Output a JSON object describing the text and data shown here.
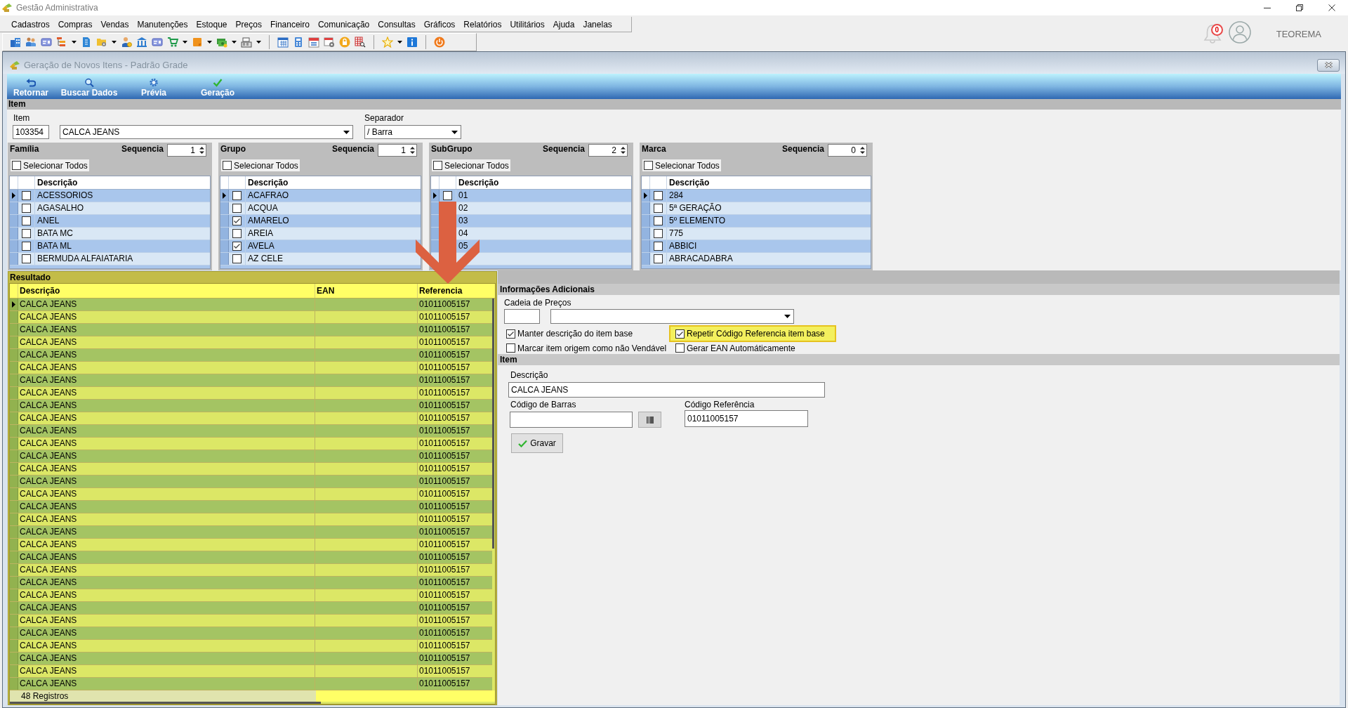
{
  "window": {
    "title": "Gestão Administrativa"
  },
  "menu": [
    "Cadastros",
    "Compras",
    "Vendas",
    "Manutenções",
    "Estoque",
    "Preços",
    "Financeiro",
    "Comunicação",
    "Consultas",
    "Gráficos",
    "Relatórios",
    "Utilitários",
    "Ajuda",
    "Janelas"
  ],
  "user_area": {
    "notifications": "0",
    "user": "TEOREMA"
  },
  "form": {
    "title": "Geração de Novos Itens - Padrão Grade",
    "actions": [
      "Retornar",
      "Buscar Dados",
      "Prévia",
      "Geração"
    ]
  },
  "item_section": {
    "title": "Item",
    "item_label": "Item",
    "item_code": "103354",
    "item_name": "CALCA JEANS",
    "separator_label": "Separador",
    "separator": "/ Barra"
  },
  "lists": [
    {
      "title": "Família",
      "sequence_label": "Sequencia",
      "sequence": "1",
      "select_all": {
        "label": "Selecionar Todos",
        "checked": false
      },
      "column": "Descrição",
      "rows": [
        {
          "label": "ACESSORIOS",
          "checked": false,
          "selected": true
        },
        {
          "label": "AGASALHO",
          "checked": false,
          "selected": false
        },
        {
          "label": "ANEL",
          "checked": false,
          "selected": false
        },
        {
          "label": "BATA MC",
          "checked": false,
          "selected": false
        },
        {
          "label": "BATA ML",
          "checked": false,
          "selected": false
        },
        {
          "label": "BERMUDA ALFAIATARIA",
          "checked": false,
          "selected": false
        }
      ]
    },
    {
      "title": "Grupo",
      "sequence_label": "Sequencia",
      "sequence": "1",
      "select_all": {
        "label": "Selecionar Todos",
        "checked": false
      },
      "column": "Descrição",
      "rows": [
        {
          "label": "ACAFRAO",
          "checked": false,
          "selected": true
        },
        {
          "label": "ACQUA",
          "checked": false,
          "selected": false
        },
        {
          "label": "AMARELO",
          "checked": true,
          "selected": false
        },
        {
          "label": "AREIA",
          "checked": false,
          "selected": false
        },
        {
          "label": "AVELA",
          "checked": true,
          "selected": false
        },
        {
          "label": "AZ CELE",
          "checked": false,
          "selected": false
        }
      ]
    },
    {
      "title": "SubGrupo",
      "sequence_label": "Sequencia",
      "sequence": "2",
      "select_all": {
        "label": "Selecionar Todos",
        "checked": false
      },
      "column": "Descrição",
      "rows": [
        {
          "label": "01",
          "checked": false,
          "selected": true
        },
        {
          "label": "02",
          "selected": false
        },
        {
          "label": "03",
          "selected": false
        },
        {
          "label": "04",
          "selected": false
        },
        {
          "label": "05",
          "selected": false
        }
      ]
    },
    {
      "title": "Marca",
      "sequence_label": "Sequencia",
      "sequence": "0",
      "select_all": {
        "label": "Selecionar Todos",
        "checked": false
      },
      "column": "Descrição",
      "rows": [
        {
          "label": "284",
          "checked": false,
          "selected": true
        },
        {
          "label": "5ª GERAÇÃO",
          "checked": false,
          "selected": false
        },
        {
          "label": "5º ELEMENTO",
          "checked": false,
          "selected": false
        },
        {
          "label": "775",
          "checked": false,
          "selected": false
        },
        {
          "label": "ABBICI",
          "checked": false,
          "selected": false
        },
        {
          "label": "ABRACADABRA",
          "checked": false,
          "selected": false
        }
      ]
    }
  ],
  "result": {
    "title": "Resultado",
    "columns": [
      "Descrição",
      "EAN",
      "Referencia"
    ],
    "rows": [
      {
        "description": "CALCA JEANS",
        "reference": "01011005157",
        "selected": true
      },
      {
        "description": "CALCA JEANS",
        "reference": "01011005157",
        "selected": false
      },
      {
        "description": "CALCA JEANS",
        "reference": "01011005157",
        "selected": false
      },
      {
        "description": "CALCA JEANS",
        "reference": "01011005157",
        "selected": false
      },
      {
        "description": "CALCA JEANS",
        "reference": "01011005157",
        "selected": false
      },
      {
        "description": "CALCA JEANS",
        "reference": "01011005157",
        "selected": false
      },
      {
        "description": "CALCA JEANS",
        "reference": "01011005157",
        "selected": false
      },
      {
        "description": "CALCA JEANS",
        "reference": "01011005157",
        "selected": false
      },
      {
        "description": "CALCA JEANS",
        "reference": "01011005157",
        "selected": false
      },
      {
        "description": "CALCA JEANS",
        "reference": "01011005157",
        "selected": false
      },
      {
        "description": "CALCA JEANS",
        "reference": "01011005157",
        "selected": false
      },
      {
        "description": "CALCA JEANS",
        "reference": "01011005157",
        "selected": false
      },
      {
        "description": "CALCA JEANS",
        "reference": "01011005157",
        "selected": false
      },
      {
        "description": "CALCA JEANS",
        "reference": "01011005157",
        "selected": false
      },
      {
        "description": "CALCA JEANS",
        "reference": "01011005157",
        "selected": false
      },
      {
        "description": "CALCA JEANS",
        "reference": "01011005157",
        "selected": false
      },
      {
        "description": "CALCA JEANS",
        "reference": "01011005157",
        "selected": false
      },
      {
        "description": "CALCA JEANS",
        "reference": "01011005157",
        "selected": false
      },
      {
        "description": "CALCA JEANS",
        "reference": "01011005157",
        "selected": false
      },
      {
        "description": "CALCA JEANS",
        "reference": "01011005157",
        "selected": false
      },
      {
        "description": "CALCA JEANS",
        "reference": "01011005157",
        "selected": false
      },
      {
        "description": "CALCA JEANS",
        "reference": "01011005157",
        "selected": false
      },
      {
        "description": "CALCA JEANS",
        "reference": "01011005157",
        "selected": false
      },
      {
        "description": "CALCA JEANS",
        "reference": "01011005157",
        "selected": false
      },
      {
        "description": "CALCA JEANS",
        "reference": "01011005157",
        "selected": false
      },
      {
        "description": "CALCA JEANS",
        "reference": "01011005157",
        "selected": false
      },
      {
        "description": "CALCA JEANS",
        "reference": "01011005157",
        "selected": false
      },
      {
        "description": "CALCA JEANS",
        "reference": "01011005157",
        "selected": false
      },
      {
        "description": "CALCA JEANS",
        "reference": "01011005157",
        "selected": false
      },
      {
        "description": "CALCA JEANS",
        "reference": "01011005157",
        "selected": false
      },
      {
        "description": "CALCA JEANS",
        "reference": "01011005157",
        "selected": false
      }
    ],
    "count": "48 Registros"
  },
  "additional": {
    "title": "Informações Adicionais",
    "price_chain_label": "Cadeia de Preços",
    "options": [
      {
        "label": "Manter descrição do item base",
        "checked": true,
        "highlighted": false
      },
      {
        "label": "Repetir Código Referencia item base",
        "checked": true,
        "highlighted": true
      },
      {
        "label": "Marcar item origem como não Vendável",
        "checked": false,
        "highlighted": false
      },
      {
        "label": "Gerar EAN Automáticamente",
        "checked": false,
        "highlighted": false
      }
    ]
  },
  "item_panel": {
    "title": "Item",
    "description_label": "Descrição",
    "description": "CALCA JEANS",
    "barcode_label": "Código de Barras",
    "reference_label": "Código Referência",
    "reference": "01011005157",
    "save": "Gravar"
  }
}
